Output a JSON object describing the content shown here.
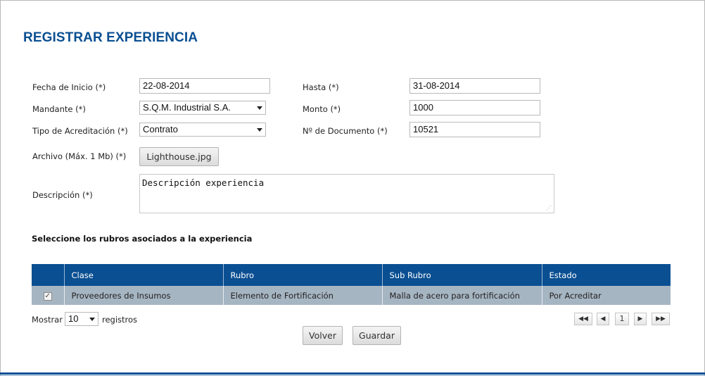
{
  "page": {
    "title": "REGISTRAR EXPERIENCIA"
  },
  "form": {
    "fecha_inicio_label": "Fecha de Inicio (*)",
    "fecha_inicio_value": "22-08-2014",
    "hasta_label": "Hasta (*)",
    "hasta_value": "31-08-2014",
    "mandante_label": "Mandante (*)",
    "mandante_value": "S.Q.M. Industrial S.A.",
    "monto_label": "Monto (*)",
    "monto_value": "1000",
    "tipo_label": "Tipo de Acreditación (*)",
    "tipo_value": "Contrato",
    "documento_label": "Nº de Documento (*)",
    "documento_value": "10521",
    "archivo_label": "Archivo (Máx. 1 Mb) (*)",
    "archivo_button": "Lighthouse.jpg",
    "descripcion_label": "Descripción (*)",
    "descripcion_value": "Descripción experiencia"
  },
  "rubros": {
    "heading": "Seleccione los rubros asociados a la experiencia",
    "columns": [
      "",
      "Clase",
      "Rubro",
      "Sub Rubro",
      "Estado"
    ],
    "rows": [
      {
        "checked": "✓",
        "clase": "Proveedores de Insumos",
        "rubro": "Elemento de Fortificación",
        "sub_rubro": "Malla de acero para fortificación",
        "estado": "Por Acreditar"
      }
    ]
  },
  "table_controls": {
    "show_label": "Mostrar",
    "page_size": "10",
    "records_label": "registros",
    "first_icon": "◀◀",
    "prev_icon": "◀",
    "current_page": "1",
    "next_icon": "▶",
    "last_icon": "▶▶"
  },
  "actions": {
    "back_label": "Volver",
    "save_label": "Guardar"
  }
}
